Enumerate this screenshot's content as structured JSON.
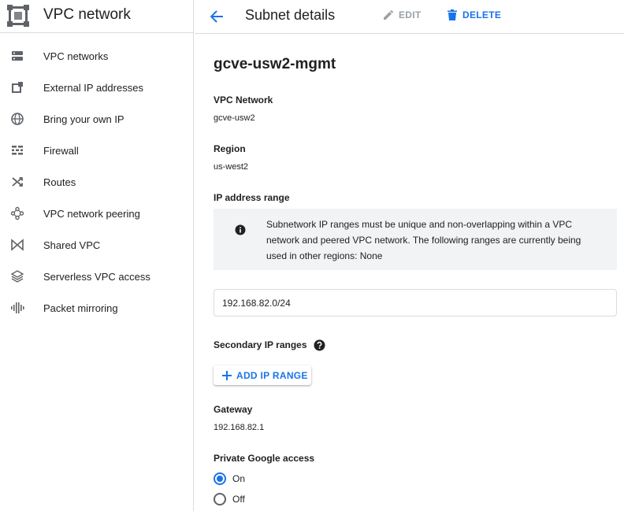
{
  "app": {
    "title": "VPC network",
    "logo_icon": "vpc-network-logo-icon"
  },
  "sidebar": {
    "items": [
      {
        "label": "VPC networks",
        "icon": "vpc-networks-icon"
      },
      {
        "label": "External IP addresses",
        "icon": "external-ip-icon"
      },
      {
        "label": "Bring your own IP",
        "icon": "globe-icon"
      },
      {
        "label": "Firewall",
        "icon": "firewall-icon"
      },
      {
        "label": "Routes",
        "icon": "routes-icon"
      },
      {
        "label": "VPC network peering",
        "icon": "peering-icon"
      },
      {
        "label": "Shared VPC",
        "icon": "shared-vpc-icon"
      },
      {
        "label": "Serverless VPC access",
        "icon": "serverless-icon"
      },
      {
        "label": "Packet mirroring",
        "icon": "packet-mirroring-icon"
      }
    ]
  },
  "header": {
    "back_icon": "arrow-back-icon",
    "title": "Subnet details",
    "edit_label": "EDIT",
    "delete_label": "DELETE"
  },
  "subnet": {
    "name": "gcve-usw2-mgmt",
    "vpc_network_label": "VPC Network",
    "vpc_network_value": "gcve-usw2",
    "region_label": "Region",
    "region_value": "us-west2",
    "ip_range_label": "IP address range",
    "info_text": "Subnetwork IP ranges must be unique and non-overlapping within a VPC network and peered VPC network. The following ranges are currently being used in other regions: None",
    "ip_range_value": "192.168.82.0/24",
    "secondary_label": "Secondary IP ranges",
    "add_range_label": "ADD IP RANGE",
    "gateway_label": "Gateway",
    "gateway_value": "192.168.82.1",
    "private_access_label": "Private Google access",
    "private_access_options": [
      {
        "label": "On",
        "selected": true
      },
      {
        "label": "Off",
        "selected": false
      }
    ]
  },
  "colors": {
    "accent": "#1a73e8",
    "icon_gray": "#5f6368",
    "disabled": "#9aa0a6",
    "info_bg": "#f1f3f4",
    "border": "#dadce0"
  }
}
